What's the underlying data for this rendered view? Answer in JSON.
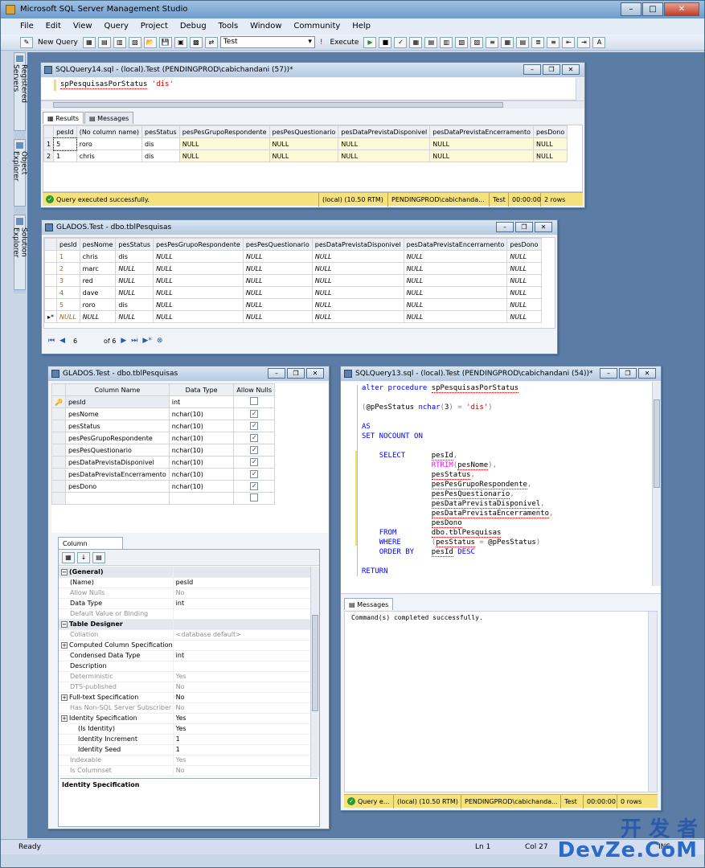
{
  "app": {
    "title": "Microsoft SQL Server Management Studio"
  },
  "menu": [
    "File",
    "Edit",
    "View",
    "Query",
    "Project",
    "Debug",
    "Tools",
    "Window",
    "Community",
    "Help"
  ],
  "toolbar": {
    "new_query": "New Query",
    "database": "Test",
    "execute": "Execute"
  },
  "side_tabs": [
    "Registered Servers",
    "Object Explorer",
    "Solution Explorer"
  ],
  "query14": {
    "title": "SQLQuery14.sql - (local).Test (PENDINGPROD\\cabichandani (57))*",
    "code_proc": "spPesquisasPorStatus",
    "code_arg": "'dis'",
    "tabs": [
      "Results",
      "Messages"
    ],
    "columns": [
      "pesId",
      "(No column name)",
      "pesStatus",
      "pesPesGrupoRespondente",
      "pesPesQuestionario",
      "pesDataPrevistaDisponivel",
      "pesDataPrevistaEncerramento",
      "pesDono"
    ],
    "rows": [
      [
        "1",
        "5",
        "roro",
        "dis",
        "NULL",
        "NULL",
        "NULL",
        "NULL",
        "NULL"
      ],
      [
        "2",
        "1",
        "chris",
        "dis",
        "NULL",
        "NULL",
        "NULL",
        "NULL",
        "NULL"
      ]
    ],
    "status": {
      "message": "Query executed successfully.",
      "server": "(local) (10.50 RTM)",
      "user": "PENDINGPROD\\cabichanda...",
      "db": "Test",
      "time": "00:00:00",
      "rows": "2 rows"
    }
  },
  "table_data": {
    "title": "GLADOS.Test - dbo.tblPesquisas",
    "columns": [
      "pesId",
      "pesNome",
      "pesStatus",
      "pesPesGrupoRespondente",
      "pesPesQuestionario",
      "pesDataPrevistaDisponivel",
      "pesDataPrevistaEncerramento",
      "pesDono"
    ],
    "rows": [
      [
        "1",
        "chris",
        "dis",
        "NULL",
        "NULL",
        "NULL",
        "NULL",
        "NULL"
      ],
      [
        "2",
        "marc",
        "NULL",
        "NULL",
        "NULL",
        "NULL",
        "NULL",
        "NULL"
      ],
      [
        "3",
        "red",
        "NULL",
        "NULL",
        "NULL",
        "NULL",
        "NULL",
        "NULL"
      ],
      [
        "4",
        "dave",
        "NULL",
        "NULL",
        "NULL",
        "NULL",
        "NULL",
        "NULL"
      ],
      [
        "5",
        "roro",
        "dis",
        "NULL",
        "NULL",
        "NULL",
        "NULL",
        "NULL"
      ],
      [
        "NULL",
        "NULL",
        "NULL",
        "NULL",
        "NULL",
        "NULL",
        "NULL",
        "NULL"
      ]
    ],
    "nav": {
      "current": "6",
      "total": "of 6"
    }
  },
  "designer": {
    "title": "GLADOS.Test - dbo.tblPesquisas",
    "headers": [
      "Column Name",
      "Data Type",
      "Allow Nulls"
    ],
    "columns": [
      {
        "name": "pesId",
        "type": "int",
        "nulls": false
      },
      {
        "name": "pesNome",
        "type": "nchar(10)",
        "nulls": true
      },
      {
        "name": "pesStatus",
        "type": "nchar(10)",
        "nulls": true
      },
      {
        "name": "pesPesGrupoRespondente",
        "type": "nchar(10)",
        "nulls": true
      },
      {
        "name": "pesPesQuestionario",
        "type": "nchar(10)",
        "nulls": true
      },
      {
        "name": "pesDataPrevistaDisponivel",
        "type": "nchar(10)",
        "nulls": true
      },
      {
        "name": "pesDataPrevistaEncerramento",
        "type": "nchar(10)",
        "nulls": true
      },
      {
        "name": "pesDono",
        "type": "nchar(10)",
        "nulls": true
      }
    ],
    "props_tab": "Column Properties",
    "props": [
      {
        "k": "(General)",
        "v": "",
        "cat": true
      },
      {
        "k": "(Name)",
        "v": "pesId"
      },
      {
        "k": "Allow Nulls",
        "v": "No",
        "dim": true
      },
      {
        "k": "Data Type",
        "v": "int"
      },
      {
        "k": "Default Value or Binding",
        "v": "",
        "dim": true
      },
      {
        "k": "Table Designer",
        "v": "",
        "cat": true
      },
      {
        "k": "Collation",
        "v": "<database default>",
        "dim": true
      },
      {
        "k": "Computed Column Specification",
        "v": "",
        "plus": true
      },
      {
        "k": "Condensed Data Type",
        "v": "int"
      },
      {
        "k": "Description",
        "v": ""
      },
      {
        "k": "Deterministic",
        "v": "Yes",
        "dim": true
      },
      {
        "k": "DTS-published",
        "v": "No",
        "dim": true
      },
      {
        "k": "Full-text Specification",
        "v": "No",
        "plus": true
      },
      {
        "k": "Has Non-SQL Server Subscriber",
        "v": "No",
        "dim": true
      },
      {
        "k": "Identity Specification",
        "v": "Yes",
        "plus": true
      },
      {
        "k": "(Is Identity)",
        "v": "Yes",
        "indent": true
      },
      {
        "k": "Identity Increment",
        "v": "1",
        "indent": true
      },
      {
        "k": "Identity Seed",
        "v": "1",
        "indent": true
      },
      {
        "k": "Indexable",
        "v": "Yes",
        "dim": true
      },
      {
        "k": "Is Columnset",
        "v": "No",
        "dim": true
      }
    ],
    "desc_title": "Identity Specification"
  },
  "query13": {
    "title": "SQLQuery13.sql - (local).Test (PENDINGPROD\\cabichandani (54))*",
    "messages_tab": "Messages",
    "message": "Command(s) completed successfully.",
    "status": {
      "message": "Query e...",
      "server": "(local) (10.50 RTM)",
      "user": "PENDINGPROD\\cabichanda...",
      "db": "Test",
      "time": "00:00:00",
      "rows": "0 rows"
    }
  },
  "statusbar": {
    "ready": "Ready",
    "ln": "Ln 1",
    "col": "Col 27",
    "ins": "INS"
  },
  "watermark": {
    "line1": "开 发 者",
    "line2": "DevZe.CoM"
  }
}
